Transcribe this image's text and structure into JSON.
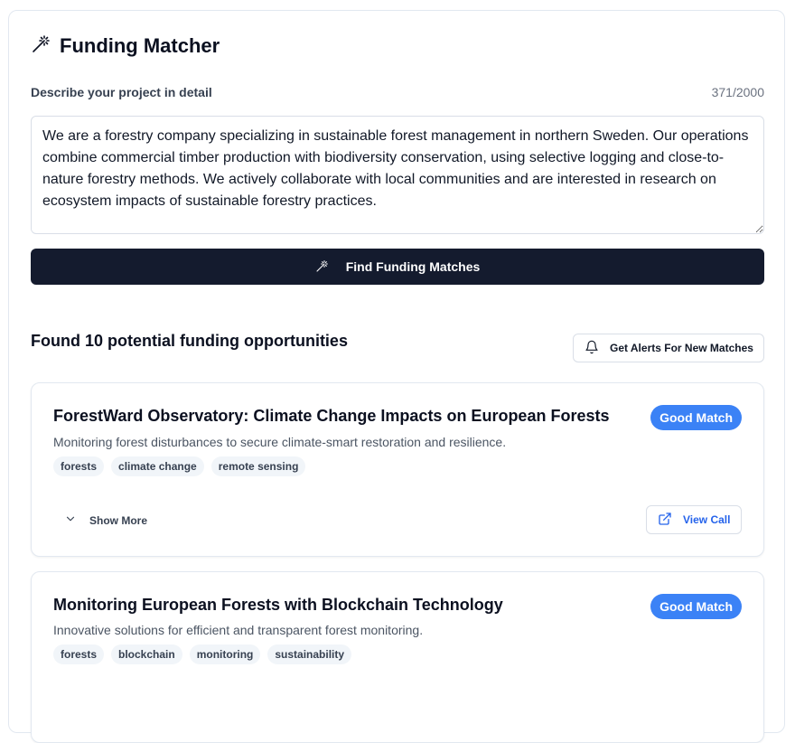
{
  "header": {
    "title": "Funding Matcher",
    "icon": "magic-wand-icon"
  },
  "form": {
    "label": "Describe your project in detail",
    "char_count": "371/2000",
    "description": "We are a forestry company specializing in sustainable forest management in northern Sweden. Our operations combine commercial timber production with biodiversity conservation, using selective logging and close-to-nature forestry methods. We actively collaborate with local communities and are interested in research on ecosystem impacts of sustainable forestry practices.",
    "submit_label": "Find Funding Matches"
  },
  "results": {
    "summary": "Found 10 potential funding opportunities",
    "alerts_label": "Get Alerts For New Matches",
    "cards": [
      {
        "title": "ForestWard Observatory: Climate Change Impacts on European Forests",
        "subtitle": "Monitoring forest disturbances to secure climate-smart restoration and resilience.",
        "badge": "Good Match",
        "tags": [
          "forests",
          "climate change",
          "remote sensing"
        ],
        "show_more": "Show More",
        "view_call": "View Call"
      },
      {
        "title": "Monitoring European Forests with Blockchain Technology",
        "subtitle": "Innovative solutions for efficient and transparent forest monitoring.",
        "badge": "Good Match",
        "tags": [
          "forests",
          "blockchain",
          "monitoring",
          "sustainability"
        ]
      }
    ]
  },
  "colors": {
    "primary_button": "#141b2e",
    "badge": "#3b82f6",
    "link": "#2563eb"
  }
}
